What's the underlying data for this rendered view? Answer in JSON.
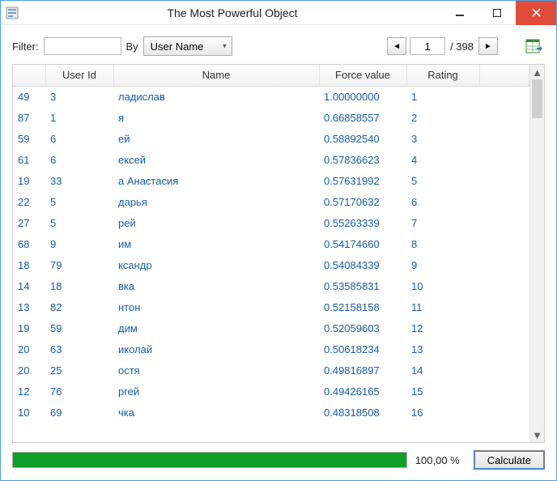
{
  "window": {
    "title": "The Most Powerful Object"
  },
  "toolbar": {
    "filter_label": "Filter:",
    "filter_value": "",
    "by_label": "By",
    "by_selected": "User Name"
  },
  "pager": {
    "current": "1",
    "total_label": "/ 398"
  },
  "columns": {
    "user_id": "User Id",
    "name": "Name",
    "force": "Force value",
    "rating": "Rating"
  },
  "rows": [
    {
      "idx": "49",
      "uid": "3",
      "name": "ладислав",
      "force": "1.00000000",
      "rating": "1"
    },
    {
      "idx": "87",
      "uid": "1",
      "name": "я",
      "force": "0.66858557",
      "rating": "2"
    },
    {
      "idx": "59",
      "uid": "6",
      "name": "ей",
      "force": "0.58892540",
      "rating": "3"
    },
    {
      "idx": "61",
      "uid": "6",
      "name": "ексей",
      "force": "0.57836623",
      "rating": "4"
    },
    {
      "idx": "19",
      "uid": "33",
      "name": "а Анастасия",
      "force": "0.57631992",
      "rating": "5"
    },
    {
      "idx": "22",
      "uid": "5",
      "name": "дарья",
      "force": "0.57170632",
      "rating": "6"
    },
    {
      "idx": "27",
      "uid": "5",
      "name": "рей",
      "force": "0.55263339",
      "rating": "7"
    },
    {
      "idx": "68",
      "uid": "9",
      "name": "им",
      "force": "0.54174660",
      "rating": "8"
    },
    {
      "idx": "18",
      "uid": "79",
      "name": "ксандр",
      "force": "0.54084339",
      "rating": "9"
    },
    {
      "idx": "14",
      "uid": "18",
      "name": "вка",
      "force": "0.53585831",
      "rating": "10"
    },
    {
      "idx": "13",
      "uid": "82",
      "name": "нтон",
      "force": "0.52158158",
      "rating": "11"
    },
    {
      "idx": "19",
      "uid": "59",
      "name": "дим",
      "force": "0.52059603",
      "rating": "12"
    },
    {
      "idx": "20",
      "uid": "63",
      "name": "иколай",
      "force": "0.50618234",
      "rating": "13"
    },
    {
      "idx": "20",
      "uid": "25",
      "name": "остя",
      "force": "0.49816897",
      "rating": "14"
    },
    {
      "idx": "12",
      "uid": "76",
      "name": "ргей",
      "force": "0.49426165",
      "rating": "15"
    },
    {
      "idx": "10",
      "uid": "69",
      "name": "чка",
      "force": "0.48318508",
      "rating": "16"
    }
  ],
  "footer": {
    "percent": "100,00 %",
    "calculate": "Calculate"
  },
  "icons": {
    "app": "app-icon",
    "min": "minimize-icon",
    "max": "maximize-icon",
    "close": "close-icon",
    "prev": "◄",
    "next": "►",
    "dropdown": "dropdown-icon",
    "excel": "excel-export-icon",
    "scroll_up": "▲",
    "scroll_down": "▼"
  }
}
